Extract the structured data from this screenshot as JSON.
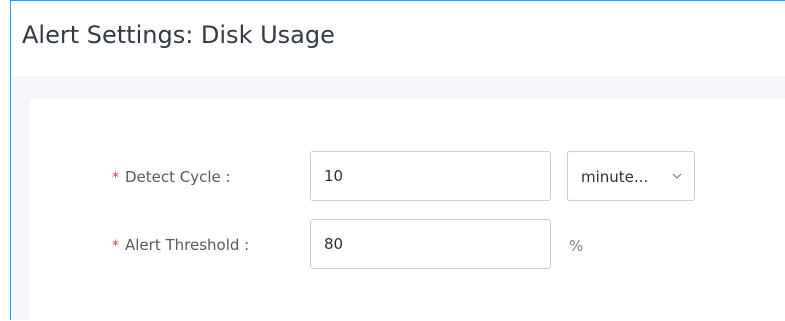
{
  "header": {
    "title": "Alert Settings: Disk Usage"
  },
  "form": {
    "required_mark": "*",
    "detect_cycle": {
      "label": "Detect Cycle :",
      "value": "10",
      "unit_select": {
        "selected": "minute...",
        "icon": "chevron-down-icon"
      }
    },
    "alert_threshold": {
      "label": "Alert Threshold :",
      "value": "80",
      "unit": "%"
    }
  },
  "colors": {
    "required": "#e04040",
    "panel_border": "#4a8fd0",
    "background": "#f4f6f9"
  }
}
